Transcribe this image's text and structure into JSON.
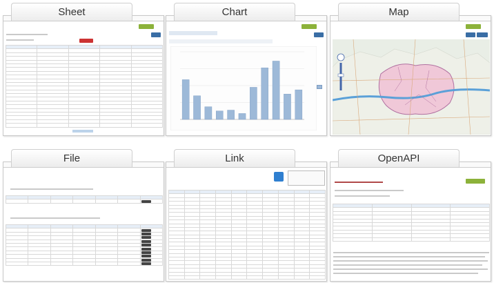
{
  "panels": {
    "sheet": {
      "label": "Sheet"
    },
    "chart": {
      "label": "Chart"
    },
    "map": {
      "label": "Map"
    },
    "file": {
      "label": "File"
    },
    "link": {
      "label": "Link"
    },
    "openapi": {
      "label": "OpenAPI"
    }
  },
  "chart_data": {
    "type": "bar",
    "values": [
      470,
      280,
      150,
      100,
      110,
      70,
      380,
      610,
      690,
      300,
      350
    ],
    "ylim": [
      0,
      800
    ],
    "bar_color": "#9db9d8"
  },
  "colors": {
    "button_green": "#8cb23a",
    "button_blue": "#3a6ea5",
    "button_red": "#cc3333",
    "table_header": "#e6eef7",
    "seoul_fill": "#f0c8d8",
    "han_river": "#5aa0d8"
  }
}
